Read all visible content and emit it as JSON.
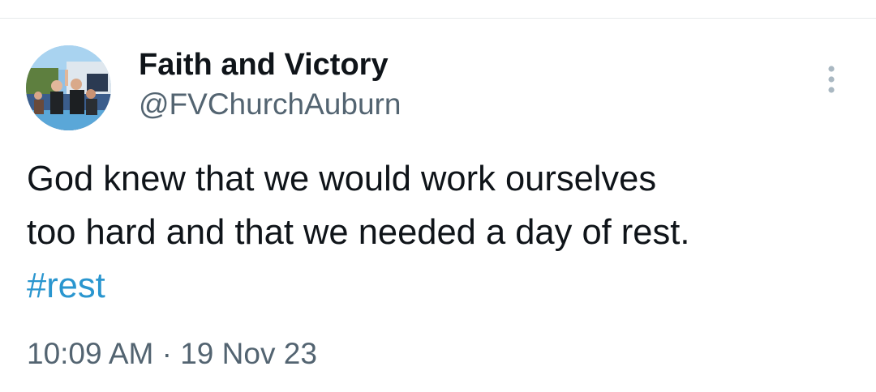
{
  "tweet": {
    "author": {
      "display_name": "Faith and Victory",
      "handle": "@FVChurchAuburn",
      "avatar_icon": "profile-photo"
    },
    "more_icon": "more-vertical-icon",
    "text_lines": [
      "God knew that we would work ourselves",
      "too hard and that we needed a day of rest."
    ],
    "hashtag": "#rest",
    "time": "10:09 AM",
    "separator": "·",
    "date": "19 Nov 23"
  },
  "colors": {
    "text_primary": "#0f1419",
    "text_secondary": "#536471",
    "hashtag": "#2a96cf",
    "divider": "#e6e9ec"
  }
}
